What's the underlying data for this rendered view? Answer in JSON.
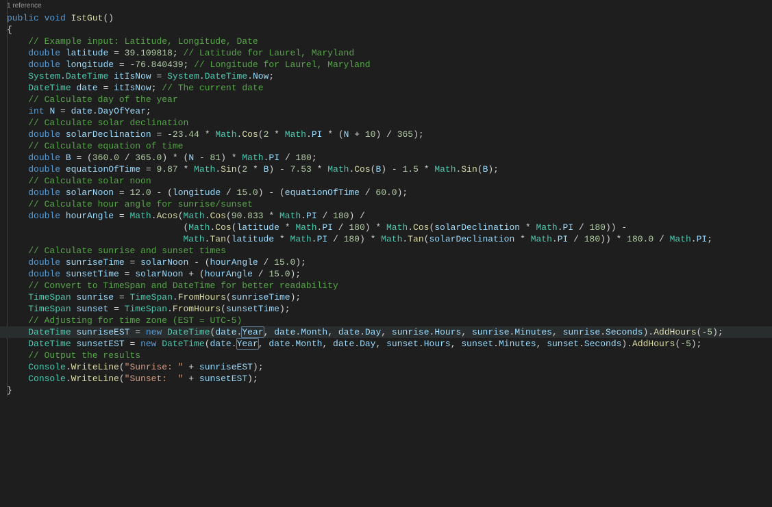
{
  "codelens": "1 reference",
  "lines": [
    [
      [
        "k",
        "public"
      ],
      [
        "p",
        " "
      ],
      [
        "k",
        "void"
      ],
      [
        "p",
        " "
      ],
      [
        "m",
        "IstGut"
      ],
      [
        "p",
        "()"
      ]
    ],
    [
      [
        "p",
        "{"
      ]
    ],
    [
      [
        "p",
        "    "
      ],
      [
        "c",
        "// Example input: Latitude, Longitude, Date"
      ]
    ],
    [
      [
        "p",
        "    "
      ],
      [
        "k",
        "double"
      ],
      [
        "p",
        " "
      ],
      [
        "v",
        "latitude"
      ],
      [
        "p",
        " = "
      ],
      [
        "n",
        "39.109818"
      ],
      [
        "p",
        "; "
      ],
      [
        "c",
        "// Latitude for Laurel, Maryland"
      ]
    ],
    [
      [
        "p",
        "    "
      ],
      [
        "k",
        "double"
      ],
      [
        "p",
        " "
      ],
      [
        "v",
        "longitude"
      ],
      [
        "p",
        " = -"
      ],
      [
        "n",
        "76.840439"
      ],
      [
        "p",
        "; "
      ],
      [
        "c",
        "// Longitude for Laurel, Maryland"
      ]
    ],
    [
      [
        "p",
        "    "
      ],
      [
        "t",
        "System"
      ],
      [
        "p",
        "."
      ],
      [
        "t",
        "DateTime"
      ],
      [
        "p",
        " "
      ],
      [
        "v",
        "itIsNow"
      ],
      [
        "p",
        " = "
      ],
      [
        "t",
        "System"
      ],
      [
        "p",
        "."
      ],
      [
        "t",
        "DateTime"
      ],
      [
        "p",
        "."
      ],
      [
        "v",
        "Now"
      ],
      [
        "p",
        ";"
      ]
    ],
    [
      [
        "p",
        "    "
      ],
      [
        "t",
        "DateTime"
      ],
      [
        "p",
        " "
      ],
      [
        "v",
        "date"
      ],
      [
        "p",
        " = "
      ],
      [
        "v",
        "itIsNow"
      ],
      [
        "p",
        "; "
      ],
      [
        "c",
        "// The current date"
      ]
    ],
    [
      [
        "p",
        ""
      ]
    ],
    [
      [
        "p",
        "    "
      ],
      [
        "c",
        "// Calculate day of the year"
      ]
    ],
    [
      [
        "p",
        "    "
      ],
      [
        "k",
        "int"
      ],
      [
        "p",
        " "
      ],
      [
        "v",
        "N"
      ],
      [
        "p",
        " = "
      ],
      [
        "v",
        "date"
      ],
      [
        "p",
        "."
      ],
      [
        "v",
        "DayOfYear"
      ],
      [
        "p",
        ";"
      ]
    ],
    [
      [
        "p",
        ""
      ]
    ],
    [
      [
        "p",
        "    "
      ],
      [
        "c",
        "// Calculate solar declination"
      ]
    ],
    [
      [
        "p",
        "    "
      ],
      [
        "k",
        "double"
      ],
      [
        "p",
        " "
      ],
      [
        "v",
        "solarDeclination"
      ],
      [
        "p",
        " = -"
      ],
      [
        "n",
        "23.44"
      ],
      [
        "p",
        " * "
      ],
      [
        "t",
        "Math"
      ],
      [
        "p",
        "."
      ],
      [
        "m",
        "Cos"
      ],
      [
        "p",
        "("
      ],
      [
        "n",
        "2"
      ],
      [
        "p",
        " * "
      ],
      [
        "t",
        "Math"
      ],
      [
        "p",
        "."
      ],
      [
        "v",
        "PI"
      ],
      [
        "p",
        " * ("
      ],
      [
        "v",
        "N"
      ],
      [
        "p",
        " + "
      ],
      [
        "n",
        "10"
      ],
      [
        "p",
        ") / "
      ],
      [
        "n",
        "365"
      ],
      [
        "p",
        ");"
      ]
    ],
    [
      [
        "p",
        ""
      ]
    ],
    [
      [
        "p",
        "    "
      ],
      [
        "c",
        "// Calculate equation of time"
      ]
    ],
    [
      [
        "p",
        "    "
      ],
      [
        "k",
        "double"
      ],
      [
        "p",
        " "
      ],
      [
        "v",
        "B"
      ],
      [
        "p",
        " = ("
      ],
      [
        "n",
        "360.0"
      ],
      [
        "p",
        " / "
      ],
      [
        "n",
        "365.0"
      ],
      [
        "p",
        ") * ("
      ],
      [
        "v",
        "N"
      ],
      [
        "p",
        " - "
      ],
      [
        "n",
        "81"
      ],
      [
        "p",
        ") * "
      ],
      [
        "t",
        "Math"
      ],
      [
        "p",
        "."
      ],
      [
        "v",
        "PI"
      ],
      [
        "p",
        " / "
      ],
      [
        "n",
        "180"
      ],
      [
        "p",
        ";"
      ]
    ],
    [
      [
        "p",
        "    "
      ],
      [
        "k",
        "double"
      ],
      [
        "p",
        " "
      ],
      [
        "v",
        "equationOfTime"
      ],
      [
        "p",
        " = "
      ],
      [
        "n",
        "9.87"
      ],
      [
        "p",
        " * "
      ],
      [
        "t",
        "Math"
      ],
      [
        "p",
        "."
      ],
      [
        "m",
        "Sin"
      ],
      [
        "p",
        "("
      ],
      [
        "n",
        "2"
      ],
      [
        "p",
        " * "
      ],
      [
        "v",
        "B"
      ],
      [
        "p",
        ") - "
      ],
      [
        "n",
        "7.53"
      ],
      [
        "p",
        " * "
      ],
      [
        "t",
        "Math"
      ],
      [
        "p",
        "."
      ],
      [
        "m",
        "Cos"
      ],
      [
        "p",
        "("
      ],
      [
        "v",
        "B"
      ],
      [
        "p",
        ") - "
      ],
      [
        "n",
        "1.5"
      ],
      [
        "p",
        " * "
      ],
      [
        "t",
        "Math"
      ],
      [
        "p",
        "."
      ],
      [
        "m",
        "Sin"
      ],
      [
        "p",
        "("
      ],
      [
        "v",
        "B"
      ],
      [
        "p",
        ");"
      ]
    ],
    [
      [
        "p",
        ""
      ]
    ],
    [
      [
        "p",
        "    "
      ],
      [
        "c",
        "// Calculate solar noon"
      ]
    ],
    [
      [
        "p",
        "    "
      ],
      [
        "k",
        "double"
      ],
      [
        "p",
        " "
      ],
      [
        "v",
        "solarNoon"
      ],
      [
        "p",
        " = "
      ],
      [
        "n",
        "12.0"
      ],
      [
        "p",
        " - ("
      ],
      [
        "v",
        "longitude"
      ],
      [
        "p",
        " / "
      ],
      [
        "n",
        "15.0"
      ],
      [
        "p",
        ") - ("
      ],
      [
        "v",
        "equationOfTime"
      ],
      [
        "p",
        " / "
      ],
      [
        "n",
        "60.0"
      ],
      [
        "p",
        ");"
      ]
    ],
    [
      [
        "p",
        ""
      ]
    ],
    [
      [
        "p",
        "    "
      ],
      [
        "c",
        "// Calculate hour angle for sunrise/sunset"
      ]
    ],
    [
      [
        "p",
        "    "
      ],
      [
        "k",
        "double"
      ],
      [
        "p",
        " "
      ],
      [
        "v",
        "hourAngle"
      ],
      [
        "p",
        " = "
      ],
      [
        "t",
        "Math"
      ],
      [
        "p",
        "."
      ],
      [
        "m",
        "Acos"
      ],
      [
        "p",
        "("
      ],
      [
        "t",
        "Math"
      ],
      [
        "p",
        "."
      ],
      [
        "m",
        "Cos"
      ],
      [
        "p",
        "("
      ],
      [
        "n",
        "90.833"
      ],
      [
        "p",
        " * "
      ],
      [
        "t",
        "Math"
      ],
      [
        "p",
        "."
      ],
      [
        "v",
        "PI"
      ],
      [
        "p",
        " / "
      ],
      [
        "n",
        "180"
      ],
      [
        "p",
        ") /"
      ]
    ],
    [
      [
        "p",
        "                                 ("
      ],
      [
        "t",
        "Math"
      ],
      [
        "p",
        "."
      ],
      [
        "m",
        "Cos"
      ],
      [
        "p",
        "("
      ],
      [
        "v",
        "latitude"
      ],
      [
        "p",
        " * "
      ],
      [
        "t",
        "Math"
      ],
      [
        "p",
        "."
      ],
      [
        "v",
        "PI"
      ],
      [
        "p",
        " / "
      ],
      [
        "n",
        "180"
      ],
      [
        "p",
        ") * "
      ],
      [
        "t",
        "Math"
      ],
      [
        "p",
        "."
      ],
      [
        "m",
        "Cos"
      ],
      [
        "p",
        "("
      ],
      [
        "v",
        "solarDeclination"
      ],
      [
        "p",
        " * "
      ],
      [
        "t",
        "Math"
      ],
      [
        "p",
        "."
      ],
      [
        "v",
        "PI"
      ],
      [
        "p",
        " / "
      ],
      [
        "n",
        "180"
      ],
      [
        "p",
        ")) -"
      ]
    ],
    [
      [
        "p",
        "                                 "
      ],
      [
        "t",
        "Math"
      ],
      [
        "p",
        "."
      ],
      [
        "m",
        "Tan"
      ],
      [
        "p",
        "("
      ],
      [
        "v",
        "latitude"
      ],
      [
        "p",
        " * "
      ],
      [
        "t",
        "Math"
      ],
      [
        "p",
        "."
      ],
      [
        "v",
        "PI"
      ],
      [
        "p",
        " / "
      ],
      [
        "n",
        "180"
      ],
      [
        "p",
        ") * "
      ],
      [
        "t",
        "Math"
      ],
      [
        "p",
        "."
      ],
      [
        "m",
        "Tan"
      ],
      [
        "p",
        "("
      ],
      [
        "v",
        "solarDeclination"
      ],
      [
        "p",
        " * "
      ],
      [
        "t",
        "Math"
      ],
      [
        "p",
        "."
      ],
      [
        "v",
        "PI"
      ],
      [
        "p",
        " / "
      ],
      [
        "n",
        "180"
      ],
      [
        "p",
        ")) * "
      ],
      [
        "n",
        "180.0"
      ],
      [
        "p",
        " / "
      ],
      [
        "t",
        "Math"
      ],
      [
        "p",
        "."
      ],
      [
        "v",
        "PI"
      ],
      [
        "p",
        ";"
      ]
    ],
    [
      [
        "p",
        ""
      ]
    ],
    [
      [
        "p",
        "    "
      ],
      [
        "c",
        "// Calculate sunrise and sunset times"
      ]
    ],
    [
      [
        "p",
        "    "
      ],
      [
        "k",
        "double"
      ],
      [
        "p",
        " "
      ],
      [
        "v",
        "sunriseTime"
      ],
      [
        "p",
        " = "
      ],
      [
        "v",
        "solarNoon"
      ],
      [
        "p",
        " - ("
      ],
      [
        "v",
        "hourAngle"
      ],
      [
        "p",
        " / "
      ],
      [
        "n",
        "15.0"
      ],
      [
        "p",
        ");"
      ]
    ],
    [
      [
        "p",
        "    "
      ],
      [
        "k",
        "double"
      ],
      [
        "p",
        " "
      ],
      [
        "v",
        "sunsetTime"
      ],
      [
        "p",
        " = "
      ],
      [
        "v",
        "solarNoon"
      ],
      [
        "p",
        " + ("
      ],
      [
        "v",
        "hourAngle"
      ],
      [
        "p",
        " / "
      ],
      [
        "n",
        "15.0"
      ],
      [
        "p",
        ");"
      ]
    ],
    [
      [
        "p",
        ""
      ]
    ],
    [
      [
        "p",
        "    "
      ],
      [
        "c",
        "// Convert to TimeSpan and DateTime for better readability"
      ]
    ],
    [
      [
        "p",
        "    "
      ],
      [
        "t",
        "TimeSpan"
      ],
      [
        "p",
        " "
      ],
      [
        "v",
        "sunrise"
      ],
      [
        "p",
        " = "
      ],
      [
        "t",
        "TimeSpan"
      ],
      [
        "p",
        "."
      ],
      [
        "m",
        "FromHours"
      ],
      [
        "p",
        "("
      ],
      [
        "v",
        "sunriseTime"
      ],
      [
        "p",
        ");"
      ]
    ],
    [
      [
        "p",
        "    "
      ],
      [
        "t",
        "TimeSpan"
      ],
      [
        "p",
        " "
      ],
      [
        "v",
        "sunset"
      ],
      [
        "p",
        " = "
      ],
      [
        "t",
        "TimeSpan"
      ],
      [
        "p",
        "."
      ],
      [
        "m",
        "FromHours"
      ],
      [
        "p",
        "("
      ],
      [
        "v",
        "sunsetTime"
      ],
      [
        "p",
        ");"
      ]
    ],
    [
      [
        "p",
        ""
      ]
    ],
    [
      [
        "p",
        "    "
      ],
      [
        "c",
        "// Adjusting for time zone (EST = UTC-5)"
      ]
    ],
    [
      [
        "p",
        "    "
      ],
      [
        "t",
        "DateTime"
      ],
      [
        "p",
        " "
      ],
      [
        "v",
        "sunriseEST"
      ],
      [
        "p",
        " = "
      ],
      [
        "k",
        "new"
      ],
      [
        "p",
        " "
      ],
      [
        "t",
        "DateTime"
      ],
      [
        "p",
        "("
      ],
      [
        "v",
        "date"
      ],
      [
        "p",
        "."
      ],
      [
        "vsel",
        "Year"
      ],
      [
        "p",
        ", "
      ],
      [
        "v",
        "date"
      ],
      [
        "p",
        "."
      ],
      [
        "v",
        "Month"
      ],
      [
        "p",
        ", "
      ],
      [
        "v",
        "date"
      ],
      [
        "p",
        "."
      ],
      [
        "v",
        "Day"
      ],
      [
        "p",
        ", "
      ],
      [
        "v",
        "sunrise"
      ],
      [
        "p",
        "."
      ],
      [
        "v",
        "Hours"
      ],
      [
        "p",
        ", "
      ],
      [
        "v",
        "sunrise"
      ],
      [
        "p",
        "."
      ],
      [
        "v",
        "Minutes"
      ],
      [
        "p",
        ", "
      ],
      [
        "v",
        "sunrise"
      ],
      [
        "p",
        "."
      ],
      [
        "v",
        "Seconds"
      ],
      [
        "p",
        ")."
      ],
      [
        "m",
        "AddHours"
      ],
      [
        "p",
        "(-"
      ],
      [
        "n",
        "5"
      ],
      [
        "p",
        ");"
      ]
    ],
    [
      [
        "p",
        "    "
      ],
      [
        "t",
        "DateTime"
      ],
      [
        "p",
        " "
      ],
      [
        "v",
        "sunsetEST"
      ],
      [
        "p",
        " = "
      ],
      [
        "k",
        "new"
      ],
      [
        "p",
        " "
      ],
      [
        "t",
        "DateTime"
      ],
      [
        "p",
        "("
      ],
      [
        "v",
        "date"
      ],
      [
        "p",
        "."
      ],
      [
        "vsel",
        "Year"
      ],
      [
        "p",
        ", "
      ],
      [
        "v",
        "date"
      ],
      [
        "p",
        "."
      ],
      [
        "v",
        "Month"
      ],
      [
        "p",
        ", "
      ],
      [
        "v",
        "date"
      ],
      [
        "p",
        "."
      ],
      [
        "v",
        "Day"
      ],
      [
        "p",
        ", "
      ],
      [
        "v",
        "sunset"
      ],
      [
        "p",
        "."
      ],
      [
        "v",
        "Hours"
      ],
      [
        "p",
        ", "
      ],
      [
        "v",
        "sunset"
      ],
      [
        "p",
        "."
      ],
      [
        "v",
        "Minutes"
      ],
      [
        "p",
        ", "
      ],
      [
        "v",
        "sunset"
      ],
      [
        "p",
        "."
      ],
      [
        "v",
        "Seconds"
      ],
      [
        "p",
        ")."
      ],
      [
        "m",
        "AddHours"
      ],
      [
        "p",
        "(-"
      ],
      [
        "n",
        "5"
      ],
      [
        "p",
        ");"
      ]
    ],
    [
      [
        "p",
        ""
      ]
    ],
    [
      [
        "p",
        "    "
      ],
      [
        "c",
        "// Output the results"
      ]
    ],
    [
      [
        "p",
        "    "
      ],
      [
        "t",
        "Console"
      ],
      [
        "p",
        "."
      ],
      [
        "m",
        "WriteLine"
      ],
      [
        "p",
        "("
      ],
      [
        "s",
        "\"Sunrise: \""
      ],
      [
        "p",
        " + "
      ],
      [
        "v",
        "sunriseEST"
      ],
      [
        "p",
        ");"
      ]
    ],
    [
      [
        "p",
        "    "
      ],
      [
        "t",
        "Console"
      ],
      [
        "p",
        "."
      ],
      [
        "m",
        "WriteLine"
      ],
      [
        "p",
        "("
      ],
      [
        "s",
        "\"Sunset:  \""
      ],
      [
        "p",
        " + "
      ],
      [
        "v",
        "sunsetEST"
      ],
      [
        "p",
        ");"
      ]
    ],
    [
      [
        "p",
        "}"
      ]
    ]
  ],
  "highlighted_line_index": 35
}
